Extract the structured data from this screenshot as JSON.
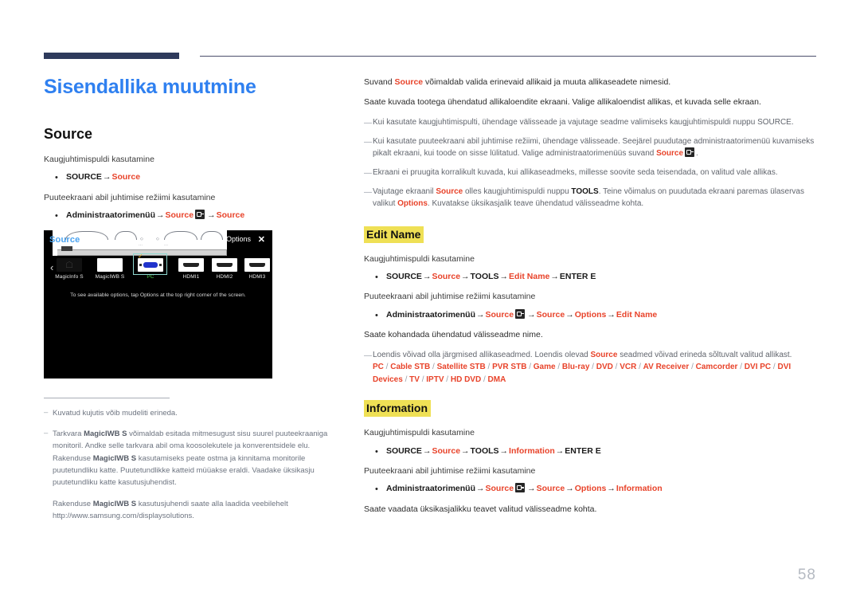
{
  "document": {
    "page_number": "58",
    "title": "Sisendallika muutmine"
  },
  "colors": {
    "title_blue": "#2f80f0",
    "accent_red": "#e8432a",
    "highlight_yellow": "#efe055",
    "rule_navy": "#2e3a5c",
    "note_gray": "#6d7480"
  },
  "left_column": {
    "section_title": "Source",
    "remote_heading": "Kaugjuhtimispuldi kasutamine",
    "remote_bullet": {
      "prefix": "SOURCE",
      "arrow": "→",
      "target": "Source"
    },
    "touch_heading": "Puuteekraani abil juhtimise režiimi kasutamine",
    "touch_bullet": {
      "prefix": "Administraatorimenüü",
      "arrow1": "→",
      "mid": "Source",
      "icon": "source-input-icon",
      "arrow2": "→",
      "target": "Source"
    },
    "screenshot": {
      "title": "Source",
      "options_label": "Options",
      "close_label": "✕",
      "nav_left": "‹",
      "nav_right": "›",
      "hint": "To see available options, tap Options at the top right corner of the screen.",
      "tiles": [
        {
          "label": "MagicInfo S",
          "type": "ghost",
          "selected": false
        },
        {
          "label": "MagicIWB S",
          "type": "plain",
          "selected": false
        },
        {
          "label": "PC",
          "type": "vga",
          "selected": true
        },
        {
          "label": "HDMI1",
          "type": "hdmi",
          "selected": false
        },
        {
          "label": "HDMI2",
          "type": "hdmi",
          "selected": false
        },
        {
          "label": "HDMI3",
          "type": "hdmi",
          "selected": false
        }
      ]
    },
    "footnotes": [
      {
        "dash": "–",
        "text": "Kuvatud kujutis võib mudeliti erineda."
      },
      {
        "dash": "–",
        "text_part_1": "Tarkvara ",
        "bold_1": "MagicIWB S",
        "text_part_2": " võimaldab esitada mitmesugust sisu suurel puuteekraaniga monitoril. Andke selle tarkvara abil oma koosolekutele ja konverentsidele elu. Rakenduse ",
        "bold_2": "MagicIWB S",
        "text_part_3": " kasutamiseks peate ostma ja kinnitama monitorile puutetundliku katte. Puutetundlikke katteid müüakse eraldi. Vaadake üksikasju puutetundliku katte kasutusjuhendist."
      }
    ],
    "footnote_sub": {
      "text_part_1": "Rakenduse ",
      "bold_1": "MagicIWB S",
      "text_part_2": " kasutusjuhendi saate alla laadida veebilehelt http://www.samsung.com/displaysolutions."
    }
  },
  "right_column": {
    "intro_1": {
      "pre": "Suvand ",
      "red": "Source",
      "post": " võimaldab valida erinevaid allikaid ja muuta allikaseadete nimesid."
    },
    "intro_2": "Saate kuvada tootega ühendatud allikaloendite ekraani. Valige allikaloendist allikas, et kuvada selle ekraan.",
    "notes": [
      {
        "dash": "—",
        "text": "Kui kasutate kaugjuhtimispulti, ühendage välisseade ja vajutage seadme valimiseks kaugjuhtimispuldi nuppu SOURCE."
      },
      {
        "dash": "—",
        "pre": "Kui kasutate puuteekraani abil juhtimise režiimi, ühendage välisseade. Seejärel puudutage administraatorimenüü kuvamiseks pikalt ekraani, kui toode on sisse lülitatud. Valige administraatorimenüüs suvand ",
        "red": "Source",
        "icon": "source-input-icon",
        "post": "."
      },
      {
        "dash": "—",
        "text": "Ekraani ei pruugita korralikult kuvada, kui allikaseadmeks, millesse soovite seda teisendada, on valitud vale allikas."
      },
      {
        "dash": "—",
        "pre": "Vajutage ekraanil ",
        "red": "Source",
        "mid": " olles kaugjuhtimispuldi nuppu ",
        "bold": "TOOLS",
        "mid2": ". Teine võimalus on puudutada ekraani paremas ülaservas valikut ",
        "red2": "Options",
        "post": ". Kuvatakse üksikasjalik teave ühendatud välisseadme kohta."
      }
    ],
    "edit_name": {
      "heading": "Edit Name",
      "remote_heading": "Kaugjuhtimispuldi kasutamine",
      "remote_bullet": {
        "p1": "SOURCE",
        "a1": "→",
        "p2": "Source",
        "a2": "→",
        "p3": "TOOLS",
        "a3": "→",
        "p4": "Edit Name",
        "a4": "→",
        "p5": "ENTER E"
      },
      "touch_heading": "Puuteekraani abil juhtimise režiimi kasutamine",
      "touch_bullet": {
        "p1": "Administraatorimenüü",
        "a1": "→",
        "p2": "Source",
        "icon": "source-input-icon",
        "a2": "→",
        "p3": "Source",
        "a3": "→",
        "p4": "Options",
        "a4": "→",
        "p5": "Edit Name"
      },
      "description": "Saate kohandada ühendatud välisseadme nime.",
      "note": {
        "dash": "—",
        "pre": "Loendis võivad olla järgmised allikaseadmed. Loendis olevad ",
        "red": "Source",
        "post": " seadmed võivad erineda sõltuvalt valitud allikast."
      },
      "device_list": [
        "PC",
        "Cable STB",
        "Satellite STB",
        "PVR STB",
        "Game",
        "Blu-ray",
        "DVD",
        "VCR",
        "AV Receiver",
        "Camcorder",
        "DVI PC",
        "DVI Devices",
        "TV",
        "IPTV",
        "HD DVD",
        "DMA"
      ],
      "device_list_separator": "/"
    },
    "information": {
      "heading": "Information",
      "remote_heading": "Kaugjuhtimispuldi kasutamine",
      "remote_bullet": {
        "p1": "SOURCE",
        "a1": "→",
        "p2": "Source",
        "a2": "→",
        "p3": "TOOLS",
        "a3": "→",
        "p4": "Information",
        "a4": "→",
        "p5": "ENTER E"
      },
      "touch_heading": "Puuteekraani abil juhtimise režiimi kasutamine",
      "touch_bullet": {
        "p1": "Administraatorimenüü",
        "a1": "→",
        "p2": "Source",
        "icon": "source-input-icon",
        "a2": "→",
        "p3": "Source",
        "a3": "→",
        "p4": "Options",
        "a4": "→",
        "p5": "Information"
      },
      "description": "Saate vaadata üksikasjalikku teavet valitud välisseadme kohta."
    }
  }
}
